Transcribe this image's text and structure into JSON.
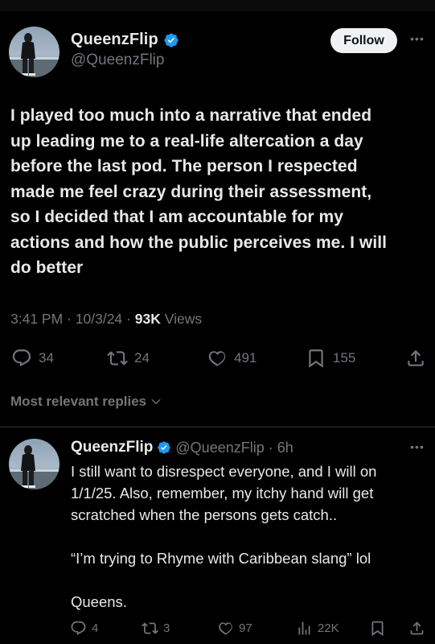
{
  "tweet": {
    "display_name": "QueenzFlip",
    "handle": "@QueenzFlip",
    "follow_label": "Follow",
    "text": "I played too much into a narrative that ended\nup leading me to a real-life altercation a day\nbefore the last pod. The person I respected\nmade me feel crazy during their assessment,\nso I decided that I am accountable for my\nactions and how the public perceives me. I will\ndo better",
    "time": "3:41 PM",
    "date": "10/3/24",
    "views_count": "93K",
    "views_label": "Views",
    "replies": "34",
    "reposts": "24",
    "likes": "491",
    "bookmarks": "155"
  },
  "replies_filter_label": "Most relevant replies",
  "reply": {
    "display_name": "QueenzFlip",
    "handle": "@QueenzFlip",
    "separator": "·",
    "time": "6h",
    "paragraphs": [
      "I still want to disrespect everyone, and I will on 1/1/25. Also, remember, my itchy hand will get scratched when the persons gets catch..",
      "“I’m trying to Rhyme with Caribbean slang” lol",
      "Queens."
    ],
    "replies": "4",
    "reposts": "3",
    "likes": "97",
    "views": "22K"
  },
  "colors": {
    "background": "#000000",
    "text": "#e7e9ea",
    "muted": "#71767b",
    "verified_blue": "#1d9bf0",
    "divider": "#2f3336",
    "follow_bg": "#eff3f4"
  },
  "icons": [
    "verified-badge-icon",
    "more-icon",
    "reply-icon",
    "repost-icon",
    "like-icon",
    "bookmark-icon",
    "share-icon",
    "views-icon",
    "chevron-down-icon"
  ]
}
